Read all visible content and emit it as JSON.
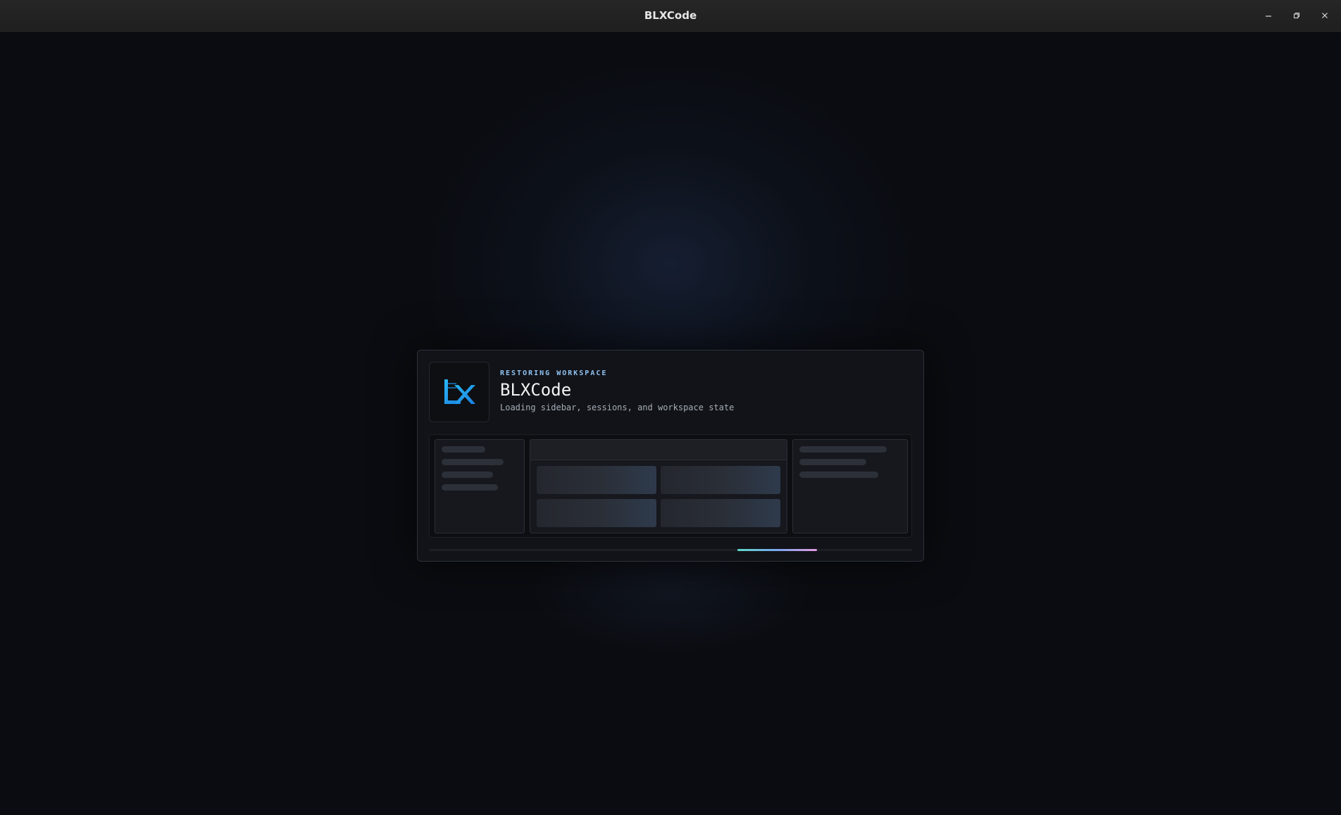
{
  "window": {
    "title": "BLXCode",
    "controls": {
      "minimize_icon": "minimize-icon",
      "maximize_icon": "restore-icon",
      "close_icon": "close-icon"
    }
  },
  "loader": {
    "eyebrow": "RESTORING WORKSPACE",
    "app_name": "BLXCode",
    "subtitle": "Loading sidebar, sessions, and workspace state",
    "logo": "blx-logo",
    "progress": {
      "indeterminate": true
    }
  },
  "colors": {
    "accent": "#8fc2f0",
    "logo_blue": "#1fa3ef",
    "progress_start": "#5fd8c8",
    "progress_end": "#e69ae0",
    "background": "#0a0c11"
  }
}
